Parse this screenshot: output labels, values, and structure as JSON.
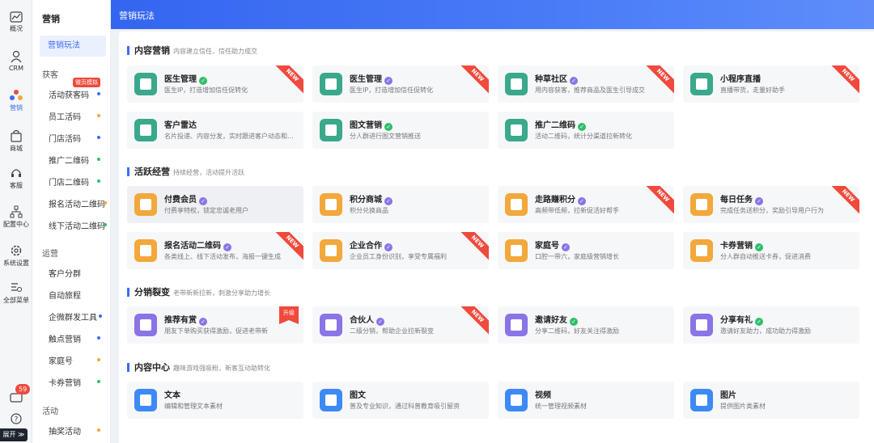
{
  "rail": {
    "items": [
      {
        "label": "概况",
        "icon": "chart-icon"
      },
      {
        "label": "CRM",
        "icon": "user-icon"
      },
      {
        "label": "营销",
        "icon": "marketing-icon"
      },
      {
        "label": "商城",
        "icon": "shop-icon"
      },
      {
        "label": "客服",
        "icon": "headset-icon"
      },
      {
        "label": "配置中心",
        "icon": "org-icon"
      },
      {
        "label": "系统设置",
        "icon": "gear-icon"
      },
      {
        "label": "全部菜单",
        "icon": "menu-icon"
      }
    ],
    "badge": "59",
    "expand": "展开 ≫"
  },
  "sub": {
    "title": "营销",
    "active": "营销玩法",
    "group1": "获客",
    "tag": "微页模拟",
    "items1": [
      "活动获客码",
      "员工活码",
      "门店活码",
      "推广二维码",
      "门店二维码",
      "报名活动二维码",
      "线下活动二维码"
    ],
    "group2": "运营",
    "items2": [
      "客户分群",
      "自动旅程",
      "企微群发工具",
      "触点营销",
      "家庭号",
      "卡券营销"
    ],
    "group3": "活动",
    "items3": [
      "抽奖活动"
    ]
  },
  "topbar": {
    "title": "营销玩法"
  },
  "sections": [
    {
      "title": "内容营销",
      "desc": "内容建立信任，信任助力成交"
    },
    {
      "title": "活跃经营",
      "desc": "持续经营，活动提升活跃"
    },
    {
      "title": "分销裂变",
      "desc": "老带新新拉新，刺激分享助力增长"
    },
    {
      "title": "内容中心",
      "desc": "趣味游戏强吸粉，新客互动助转化"
    }
  ],
  "cards": [
    {
      "title": "医生管理",
      "desc": "医生IP，打造增加信任促转化",
      "color": "#3aa88b",
      "verify": "green",
      "ribbon": "NEW"
    },
    {
      "title": "医生管理",
      "desc": "医生IP，打造增加信任促转化",
      "color": "#3aa88b",
      "verify": "purple",
      "ribbon": "NEW"
    },
    {
      "title": "种草社区",
      "desc": "用内容获客，推荐商品及医生引导成交",
      "color": "#3aa88b",
      "verify": "purple",
      "ribbon": "NEW"
    },
    {
      "title": "小程序直播",
      "desc": "直播带货，走量好助手",
      "color": "#3aa88b",
      "verify": "",
      "ribbon": "NEW"
    },
    {
      "title": "客户雷达",
      "desc": "名片投递、内容分发，实时跟进客户动态和...",
      "color": "#3aa88b",
      "verify": "",
      "ribbon": ""
    },
    {
      "title": "图文营销",
      "desc": "分人群进行图文营销推送",
      "color": "#3aa88b",
      "verify": "green",
      "ribbon": ""
    },
    {
      "title": "推广二维码",
      "desc": "活动二维码，统计分渠道拉新转化",
      "color": "#3aa88b",
      "verify": "green",
      "ribbon": ""
    },
    {
      "title": "付费会员",
      "desc": "付费享特权，锁定忠诚老用户",
      "color": "#f2a83b",
      "verify": "purple",
      "ribbon": ""
    },
    {
      "title": "积分商城",
      "desc": "积分兑换商品",
      "color": "#f2a83b",
      "verify": "purple",
      "ribbon": ""
    },
    {
      "title": "走路赚积分",
      "desc": "高频带低频，拉新促活好帮手",
      "color": "#f2a83b",
      "verify": "purple",
      "ribbon": "NEW"
    },
    {
      "title": "每日任务",
      "desc": "完成任务送积分，奖励引导用户行为",
      "color": "#f2a83b",
      "verify": "purple",
      "ribbon": "NEW"
    },
    {
      "title": "报名活动二维码",
      "desc": "各类线上、线下活动发布，海报一键生成",
      "color": "#f2a83b",
      "verify": "purple",
      "ribbon": "NEW"
    },
    {
      "title": "企业合作",
      "desc": "企业员工身份识别，享受专属福利",
      "color": "#f2a83b",
      "verify": "purple",
      "ribbon": "NEW"
    },
    {
      "title": "家庭号",
      "desc": "口腔一带六，家庭级营销增长",
      "color": "#f2a83b",
      "verify": "purple",
      "ribbon": ""
    },
    {
      "title": "卡券营销",
      "desc": "分人群自动推送卡券，促进消费",
      "color": "#f2a83b",
      "verify": "green",
      "ribbon": ""
    },
    {
      "title": "推荐有赏",
      "desc": "朋友下单购买获得激励，促进老带新",
      "color": "#8a74e6",
      "verify": "purple",
      "ribbon": "",
      "upgrade": "升级"
    },
    {
      "title": "合伙人",
      "desc": "二级分销，帮助企业拉新裂变",
      "color": "#8a74e6",
      "verify": "purple",
      "ribbon": "NEW"
    },
    {
      "title": "邀请好友",
      "desc": "分享二维码，好友关注得激励",
      "color": "#8a74e6",
      "verify": "green",
      "ribbon": ""
    },
    {
      "title": "分享有礼",
      "desc": "邀请好友助力，成功助力得激励",
      "color": "#8a74e6",
      "verify": "green",
      "ribbon": ""
    },
    {
      "title": "文本",
      "desc": "编辑和管理文本素材",
      "color": "#3d8af5",
      "verify": "",
      "ribbon": ""
    },
    {
      "title": "图文",
      "desc": "普及专业知识，通过科普教育吸引留资",
      "color": "#3d8af5",
      "verify": "",
      "ribbon": ""
    },
    {
      "title": "视频",
      "desc": "统一管理视频素材",
      "color": "#3d8af5",
      "verify": "",
      "ribbon": ""
    },
    {
      "title": "图片",
      "desc": "提供图片类素材",
      "color": "#3d8af5",
      "verify": "",
      "ribbon": ""
    }
  ]
}
